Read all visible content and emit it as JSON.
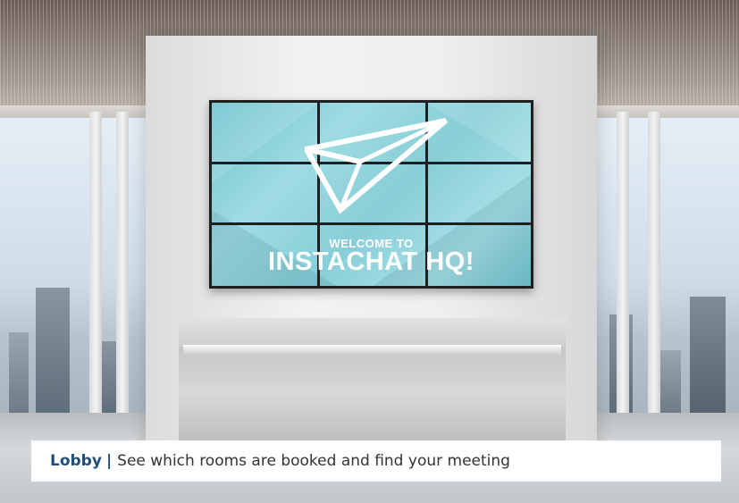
{
  "screen": {
    "welcome_line1": "WELCOME TO",
    "welcome_line2": "INSTACHAT HQ!"
  },
  "caption": {
    "title": "Lobby",
    "separator": "|",
    "text": "See which rooms are booked and find your meeting"
  },
  "colors": {
    "screen_background": "#8fd3db",
    "caption_accent": "#1f4d7a",
    "caption_text": "#333333"
  },
  "icons": {
    "screen_logo": "paper-plane-icon"
  }
}
